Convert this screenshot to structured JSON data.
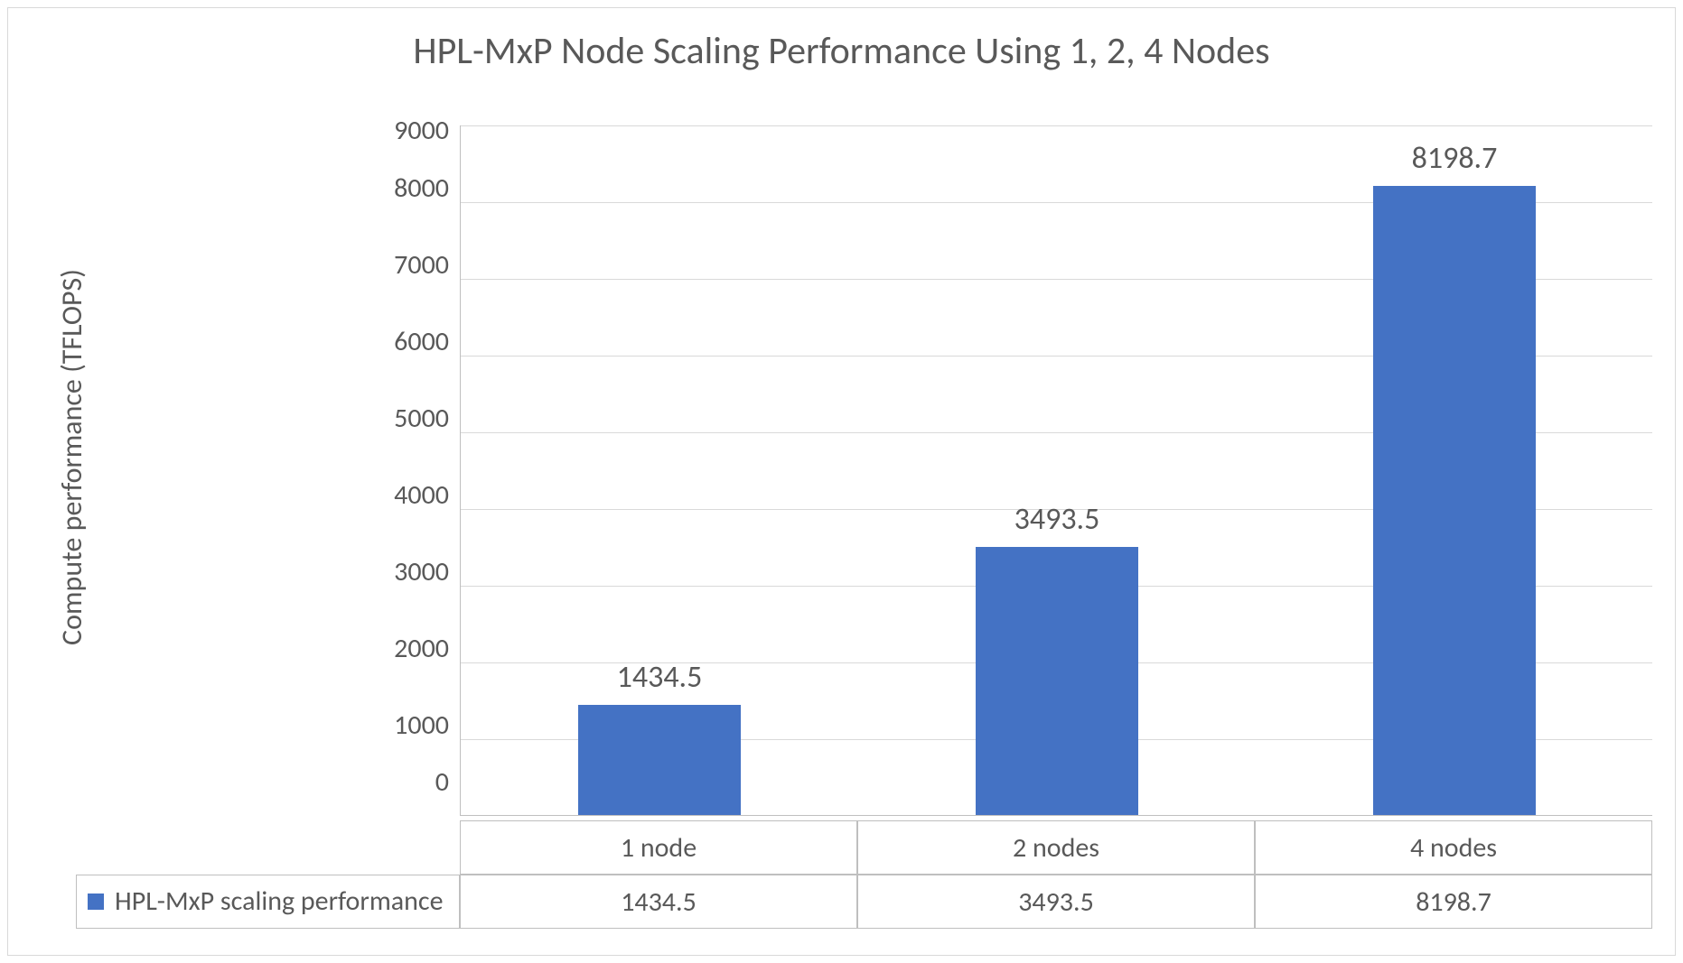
{
  "chart_data": {
    "type": "bar",
    "title": "HPL-MxP Node Scaling Performance Using 1, 2, 4 Nodes",
    "ylabel": "Compute performance (TFLOPS)",
    "xlabel": "",
    "categories": [
      "1 node",
      "2 nodes",
      "4 nodes"
    ],
    "series": [
      {
        "name": "HPL-MxP scaling performance",
        "values": [
          1434.5,
          3493.5,
          8198.7
        ]
      }
    ],
    "ylim": [
      0,
      9000
    ],
    "ytick_step": 1000,
    "yticks": [
      0,
      1000,
      2000,
      3000,
      4000,
      5000,
      6000,
      7000,
      8000,
      9000
    ],
    "grid": true,
    "legend_position": "bottom-table",
    "series_color": "#4472c4"
  }
}
